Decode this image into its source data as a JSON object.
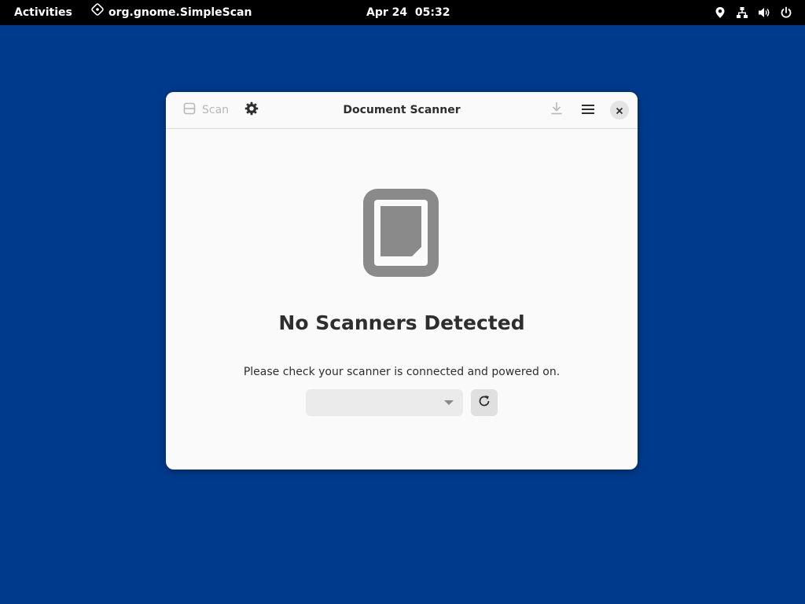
{
  "topbar": {
    "activities": "Activities",
    "app_name": "org.gnome.SimpleScan",
    "clock": "Apr 24  05:32",
    "tray_icons": [
      "location-icon",
      "network-icon",
      "volume-icon",
      "power-icon"
    ]
  },
  "window": {
    "title": "Document Scanner",
    "scan_label": "Scan",
    "header_icons": [
      "scan-icon",
      "gear-icon",
      "download-icon",
      "hamburger-menu-icon",
      "close-icon"
    ]
  },
  "content": {
    "heading": "No Scanners Detected",
    "message": "Please check your scanner is connected and powered on.",
    "device_selected": "",
    "icon": "scanner-icon"
  },
  "colors": {
    "desktop": "#003a8c",
    "topbar": "#000000",
    "window_bg": "#fafafa",
    "icon_gray": "#8a8a8a",
    "text": "#2e2e2e"
  }
}
